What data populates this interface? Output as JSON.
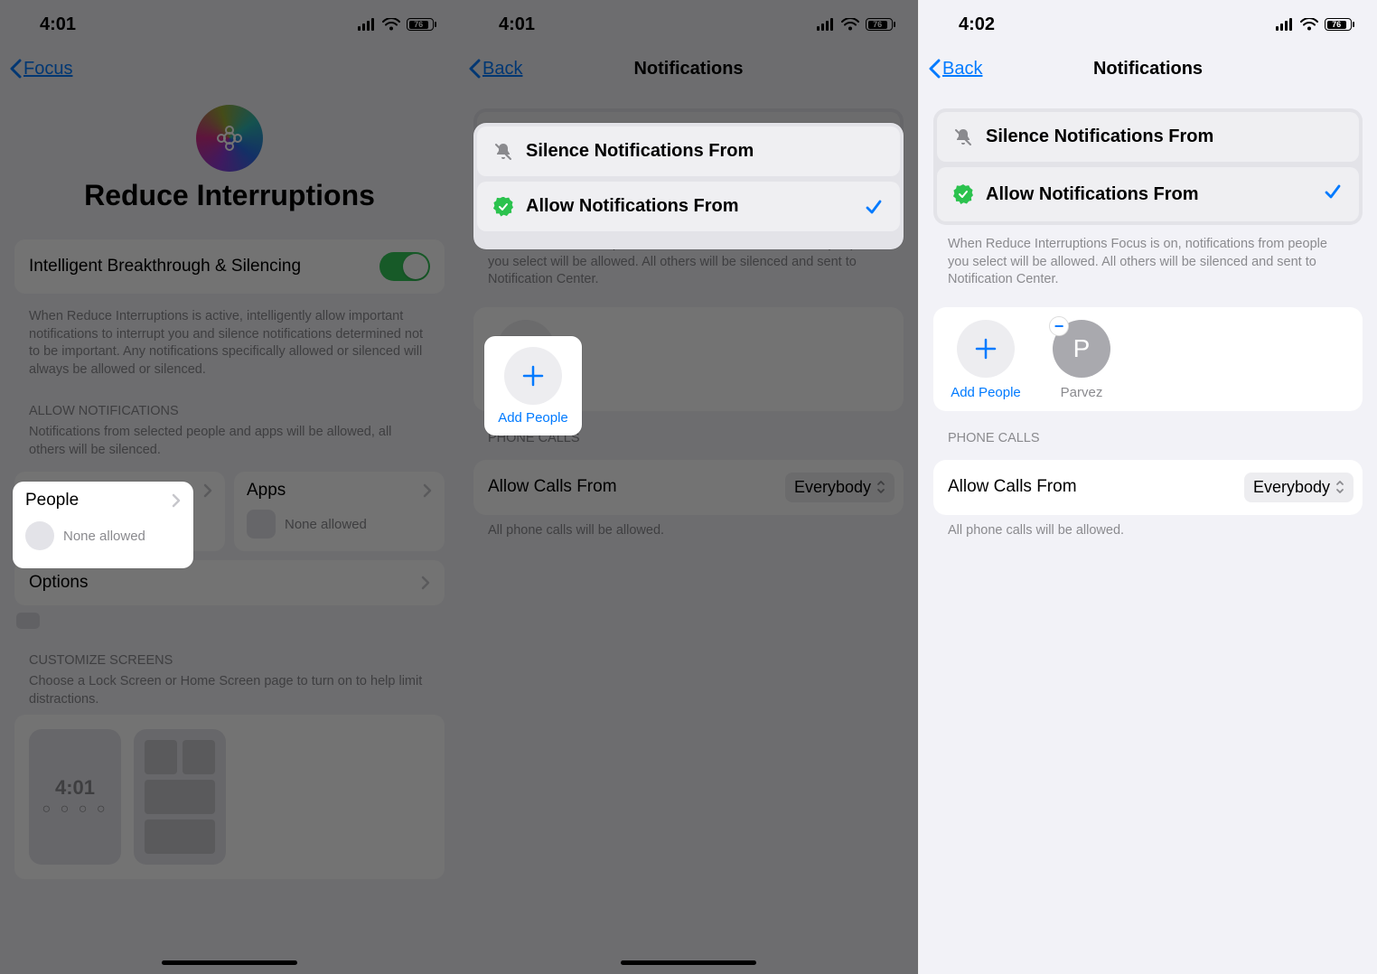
{
  "status": {
    "time_a": "4:01",
    "time_b": "4:01",
    "time_c": "4:02",
    "battery_pct": "76"
  },
  "screen1": {
    "back_label": "Focus",
    "page_title": "Reduce Interruptions",
    "toggle_label": "Intelligent Breakthrough & Silencing",
    "toggle_desc": "When Reduce Interruptions is active, intelligently allow important notifications to interrupt you and silence notifications determined not to be important. Any notifications specifically allowed or silenced will always be allowed or silenced.",
    "allow_header": "ALLOW NOTIFICATIONS",
    "allow_desc": "Notifications from selected people and apps will be allowed, all others will be silenced.",
    "people_label": "People",
    "people_status": "None allowed",
    "apps_label": "Apps",
    "apps_status": "None allowed",
    "options_label": "Options",
    "customize_header": "CUSTOMIZE SCREENS",
    "customize_desc": "Choose a Lock Screen or Home Screen page to turn on to help limit distractions.",
    "preview_time": "4:01"
  },
  "screen2": {
    "back_label": "Back",
    "page_title": "Notifications",
    "silence_label": "Silence Notifications From",
    "allow_label": "Allow Notifications From",
    "desc": "When Reduce Interruptions Focus is on, notifications from people you select will be allowed. All others will be silenced and sent to Notification Center.",
    "add_label": "Add People",
    "calls_header": "PHONE CALLS",
    "calls_label": "Allow Calls From",
    "calls_value": "Everybody",
    "calls_desc": "All phone calls will be allowed."
  },
  "screen3": {
    "back_label": "Back",
    "page_title": "Notifications",
    "silence_label": "Silence Notifications From",
    "allow_label": "Allow Notifications From",
    "desc": "When Reduce Interruptions Focus is on, notifications from people you select will be allowed. All others will be silenced and sent to Notification Center.",
    "add_label": "Add People",
    "contact_initial": "P",
    "contact_name": "Parvez",
    "calls_header": "PHONE CALLS",
    "calls_label": "Allow Calls From",
    "calls_value": "Everybody",
    "calls_desc": "All phone calls will be allowed."
  }
}
